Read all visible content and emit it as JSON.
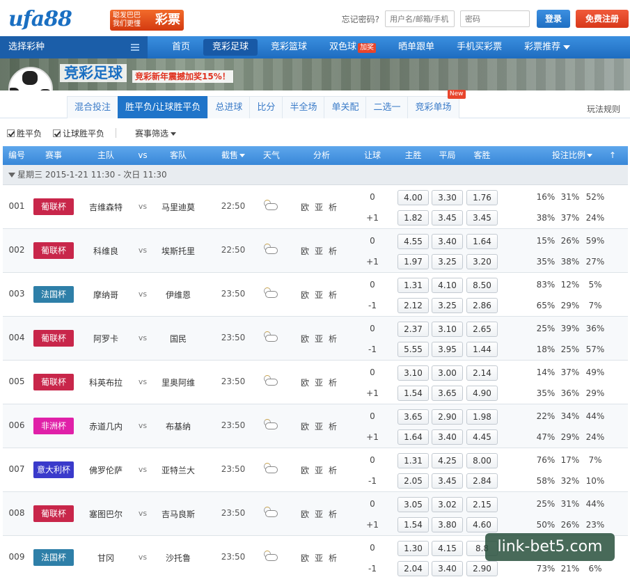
{
  "header": {
    "logo_text": "ufa88",
    "logo_badge_small": "聪发巴巴\n我们更懂",
    "logo_badge_big": "彩票",
    "forgot_password": "忘记密码?",
    "username_placeholder": "用户名/邮箱/手机",
    "password_placeholder": "密码",
    "login_label": "登录",
    "register_label": "免费注册"
  },
  "nav": {
    "select_label": "选择彩种",
    "items": [
      {
        "label": "首页"
      },
      {
        "label": "竞彩足球"
      },
      {
        "label": "竞彩篮球"
      },
      {
        "label": "双色球",
        "badge": "加奖"
      },
      {
        "label": "晒单跟单"
      },
      {
        "label": "手机买彩票"
      },
      {
        "label": "彩票推荐"
      }
    ]
  },
  "banner": {
    "title": "竞彩足球",
    "promo": "竞彩新年震撼加奖15%！",
    "ball_tag": "竞彩"
  },
  "subtabs": {
    "items": [
      {
        "label": "混合投注"
      },
      {
        "label": "胜平负/让球胜平负"
      },
      {
        "label": "总进球"
      },
      {
        "label": "比分"
      },
      {
        "label": "半全场"
      },
      {
        "label": "单关配"
      },
      {
        "label": "二选一"
      },
      {
        "label": "竞彩单场",
        "badge": "New"
      }
    ],
    "rules_label": "玩法规则"
  },
  "filters": {
    "check1": "胜平负",
    "check2": "让球胜平负",
    "event_filter": "赛事筛选"
  },
  "table": {
    "headers": {
      "id": "编号",
      "league": "赛事",
      "home": "主队",
      "vs": "vs",
      "away": "客队",
      "deadline": "截售",
      "weather": "天气",
      "analysis": "分析",
      "handicap": "让球",
      "win": "主胜",
      "draw": "平局",
      "lose": "客胜",
      "ratio": "投注比例",
      "top": "↑"
    },
    "date_group": "星期三 2015-1-21 11:30 - 次日 11:30",
    "analysis_links": "欧亚析",
    "vs_text": "vs",
    "rows": [
      {
        "id": "001",
        "league": "葡联杯",
        "league_color": "#c8264a",
        "home": "吉维森特",
        "away": "马里迪莫",
        "time": "22:50",
        "weather": "cloud-rain-icon",
        "hc1": "0",
        "hc2": "+1",
        "odds1": [
          "4.00",
          "3.30",
          "1.76"
        ],
        "odds2": [
          "1.82",
          "3.45",
          "3.45"
        ],
        "pct1": [
          "16%",
          "31%",
          "52%"
        ],
        "pct2": [
          "38%",
          "37%",
          "24%"
        ]
      },
      {
        "id": "002",
        "league": "葡联杯",
        "league_color": "#c8264a",
        "home": "科维良",
        "away": "埃斯托里",
        "time": "22:50",
        "weather": "sun-cloud-icon",
        "hc1": "0",
        "hc2": "+1",
        "odds1": [
          "4.55",
          "3.40",
          "1.64"
        ],
        "odds2": [
          "1.97",
          "3.25",
          "3.20"
        ],
        "pct1": [
          "15%",
          "26%",
          "59%"
        ],
        "pct2": [
          "35%",
          "38%",
          "27%"
        ]
      },
      {
        "id": "003",
        "league": "法国杯",
        "league_color": "#2e7fa8",
        "home": "摩纳哥",
        "away": "伊维恩",
        "time": "23:50",
        "weather": "sun-cloud-icon",
        "hc1": "0",
        "hc2": "-1",
        "odds1": [
          "1.31",
          "4.10",
          "8.50"
        ],
        "odds2": [
          "2.12",
          "3.25",
          "2.86"
        ],
        "pct1": [
          "83%",
          "12%",
          "5%"
        ],
        "pct2": [
          "65%",
          "29%",
          "7%"
        ]
      },
      {
        "id": "004",
        "league": "葡联杯",
        "league_color": "#c8264a",
        "home": "阿罗卡",
        "away": "国民",
        "time": "23:50",
        "weather": "sun-cloud-icon",
        "hc1": "0",
        "hc2": "-1",
        "odds1": [
          "2.37",
          "3.10",
          "2.65"
        ],
        "odds2": [
          "5.55",
          "3.95",
          "1.44"
        ],
        "pct1": [
          "25%",
          "39%",
          "36%"
        ],
        "pct2": [
          "18%",
          "25%",
          "57%"
        ]
      },
      {
        "id": "005",
        "league": "葡联杯",
        "league_color": "#c8264a",
        "home": "科英布拉",
        "away": "里奥阿维",
        "time": "23:50",
        "weather": "sun-cloud-icon",
        "hc1": "0",
        "hc2": "+1",
        "odds1": [
          "3.10",
          "3.00",
          "2.14"
        ],
        "odds2": [
          "1.54",
          "3.65",
          "4.90"
        ],
        "pct1": [
          "14%",
          "37%",
          "49%"
        ],
        "pct2": [
          "35%",
          "36%",
          "29%"
        ]
      },
      {
        "id": "006",
        "league": "非洲杯",
        "league_color": "#e020a8",
        "home": "赤道几内",
        "away": "布基纳",
        "time": "23:50",
        "weather": "sun-cloud-icon",
        "hc1": "0",
        "hc2": "+1",
        "odds1": [
          "3.65",
          "2.90",
          "1.98"
        ],
        "odds2": [
          "1.64",
          "3.40",
          "4.45"
        ],
        "pct1": [
          "22%",
          "34%",
          "44%"
        ],
        "pct2": [
          "47%",
          "29%",
          "24%"
        ]
      },
      {
        "id": "007",
        "league": "意大利杯",
        "league_color": "#3a3acb",
        "home": "佛罗伦萨",
        "away": "亚特兰大",
        "time": "23:50",
        "weather": "sun-cloud-icon",
        "hc1": "0",
        "hc2": "-1",
        "odds1": [
          "1.31",
          "4.25",
          "8.00"
        ],
        "odds2": [
          "2.05",
          "3.45",
          "2.84"
        ],
        "pct1": [
          "76%",
          "17%",
          "7%"
        ],
        "pct2": [
          "58%",
          "32%",
          "10%"
        ]
      },
      {
        "id": "008",
        "league": "葡联杯",
        "league_color": "#c8264a",
        "home": "塞图巴尔",
        "away": "吉马良斯",
        "time": "23:50",
        "weather": "sun-cloud-icon",
        "hc1": "0",
        "hc2": "+1",
        "odds1": [
          "3.05",
          "3.02",
          "2.15"
        ],
        "odds2": [
          "1.54",
          "3.80",
          "4.60"
        ],
        "pct1": [
          "25%",
          "31%",
          "44%"
        ],
        "pct2": [
          "50%",
          "26%",
          "23%"
        ]
      },
      {
        "id": "009",
        "league": "法国杯",
        "league_color": "#2e7fa8",
        "home": "甘冈",
        "away": "沙托鲁",
        "time": "23:50",
        "weather": "sun-cloud-icon",
        "hc1": "0",
        "hc2": "-1",
        "odds1": [
          "1.30",
          "4.15",
          "8.8"
        ],
        "odds2": [
          "2.04",
          "3.40",
          "2.90"
        ],
        "pct1": [
          "",
          "",
          ""
        ],
        "pct2": [
          "73%",
          "21%",
          "6%"
        ]
      }
    ]
  },
  "watermark": "link-bet5.com"
}
